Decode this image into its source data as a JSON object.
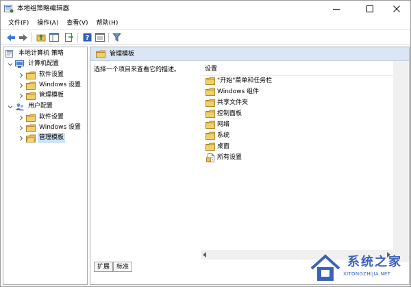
{
  "window": {
    "title": "本地组策略编辑器",
    "controls": {
      "minimize": "minimize",
      "maximize": "maximize",
      "close": "close"
    }
  },
  "menu": {
    "items": [
      {
        "label": "文件(F)"
      },
      {
        "label": "操作(A)"
      },
      {
        "label": "查看(V)"
      },
      {
        "label": "帮助(H)"
      }
    ]
  },
  "toolbar": {
    "icons": [
      "back-arrow-icon",
      "forward-arrow-icon",
      "up-folder-icon",
      "show-hide-tree-icon",
      "export-list-icon",
      "help-icon",
      "properties-icon",
      "filter-icon"
    ]
  },
  "tree": {
    "root": {
      "label": "本地计算机 策略"
    },
    "computer_config": {
      "label": "计算机配置",
      "children": [
        {
          "label": "软件设置"
        },
        {
          "label": "Windows 设置"
        },
        {
          "label": "管理模板"
        }
      ]
    },
    "user_config": {
      "label": "用户配置",
      "children": [
        {
          "label": "软件设置"
        },
        {
          "label": "Windows 设置"
        },
        {
          "label": "管理模板"
        }
      ]
    }
  },
  "content": {
    "header_title": "管理模板",
    "description": "选择一个项目来查看它的描述。",
    "list_header": "设置",
    "items": [
      {
        "label": "\"开始\"菜单和任务栏",
        "icon": "folder-icon"
      },
      {
        "label": "Windows 组件",
        "icon": "folder-icon"
      },
      {
        "label": "共享文件夹",
        "icon": "folder-icon"
      },
      {
        "label": "控制面板",
        "icon": "folder-icon"
      },
      {
        "label": "网络",
        "icon": "folder-icon"
      },
      {
        "label": "系统",
        "icon": "folder-icon"
      },
      {
        "label": "桌面",
        "icon": "folder-icon"
      },
      {
        "label": "所有设置",
        "icon": "all-settings-icon"
      }
    ]
  },
  "tabs": [
    {
      "label": "扩展"
    },
    {
      "label": "标准"
    }
  ],
  "watermark": {
    "brand": "系统之家",
    "url": "XITONGZHIJIA.NET"
  },
  "colors": {
    "selection": "#cce4f7",
    "header_bg": "#dbe6f4",
    "folder": "#e9c05a",
    "brand_blue": "#3a63b8"
  }
}
